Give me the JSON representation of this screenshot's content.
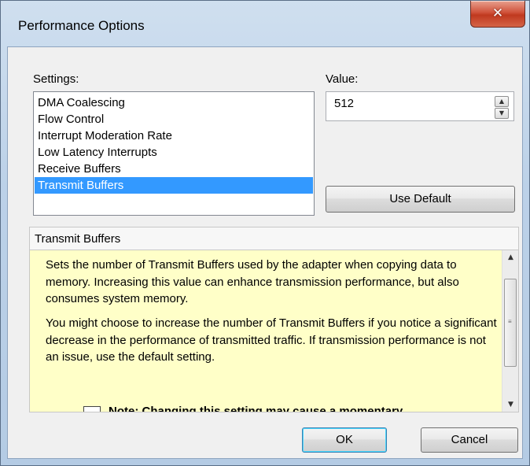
{
  "window": {
    "title": "Performance Options"
  },
  "settings": {
    "label": "Settings:",
    "items": [
      "DMA Coalescing",
      "Flow Control",
      "Interrupt Moderation Rate",
      "Low Latency Interrupts",
      "Receive Buffers",
      "Transmit Buffers"
    ],
    "selected": "Transmit Buffers"
  },
  "value": {
    "label": "Value:",
    "current": "512"
  },
  "buttons": {
    "use_default": "Use Default",
    "ok": "OK",
    "cancel": "Cancel"
  },
  "help": {
    "title": "Transmit Buffers",
    "paragraph1": "Sets the number of Transmit Buffers used by the adapter when copying data to memory. Increasing this value can enhance transmission performance, but also consumes system memory.",
    "paragraph2": "You might choose to increase the number of Transmit Buffers if you notice a significant decrease in the performance of transmitted traffic. If transmission performance is not an issue, use the default setting.",
    "note": "Note: Changing this setting may cause a momentary"
  },
  "icons": {
    "close": "close-icon",
    "spin_up": "spin-up-icon",
    "spin_down": "spin-down-icon",
    "note": "note-icon"
  },
  "colors": {
    "selection": "#3399ff",
    "help_background": "#ffffc8",
    "close_button": "#c7432a"
  }
}
